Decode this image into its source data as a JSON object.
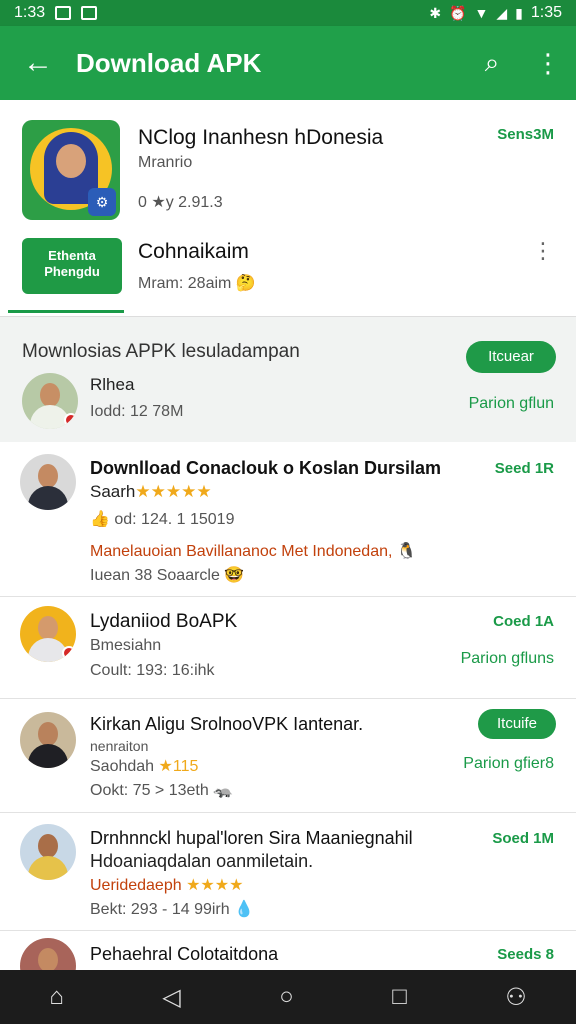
{
  "status_bar": {
    "time_left": "1:33",
    "time_right": "1:35"
  },
  "app_bar": {
    "back_icon": "arrow-left-icon",
    "title": "Download APK",
    "search_icon": "search-icon",
    "more_icon": "more-vert-icon"
  },
  "featured": [
    {
      "title": "NClog Inanhesn hDonesia",
      "subtitle": "Mranrio",
      "meta": "0 ★y 2.91.3",
      "size": "Sens3M"
    },
    {
      "icon_text": "Ethenta Phengdu",
      "title": "Cohnaikaim",
      "meta": "Mram: 28aim 🤔"
    }
  ],
  "section": {
    "title": "Mownlosias APPK lesuladampan",
    "button": "Itcuear",
    "item_name": "Rlhea",
    "item_meta": "Iodd: 12 78M",
    "item_action": "Parion gflun"
  },
  "list": [
    {
      "title": "Downlload Conaclouk o Koslan Dursilam",
      "line2": "Saarh",
      "stars": "★★★★★",
      "line3": "👍 od: 124. 1 15019",
      "line4": "Manelauoian Bavillananoc Met Indonedan, 🐧",
      "line5": "Iuean 38 Soaarcle 🤓",
      "size": "Seed 1R"
    },
    {
      "title": "Lydaniiod BoAPK",
      "line2": "Bmesiahn",
      "line3": "Coult: 193: 16:ihk",
      "size": "Coed 1A",
      "action": "Parion gfluns"
    },
    {
      "title": "Kirkan Aligu SrolnooVPK Iantenar.",
      "line2": "nenraiton",
      "line3": "Saohdah",
      "stars": "★115",
      "line4": "Ookt: 75 > 13eth 🦡",
      "button": "Itcuife",
      "action": "Parion gfier8"
    },
    {
      "title": "Drnhnnckl hupal'loren Sira Maaniegnahil",
      "line2": "Hdoaniaqdalan oanmiletain.",
      "line3": "Ueridedaeph",
      "stars": "★★★★",
      "line4": "Bekt: 293 - 14 99irh 💧",
      "size": "Soed 1M"
    },
    {
      "title": "Pehaehral Colotaitdona",
      "size": "Seeds 8"
    }
  ],
  "nav_bar": {
    "home_icon": "home-shape-icon",
    "back_icon": "triangle-back-icon",
    "home_circle_icon": "circle-home-icon",
    "recents_icon": "square-recents-icon",
    "account_icon": "account-icon"
  }
}
